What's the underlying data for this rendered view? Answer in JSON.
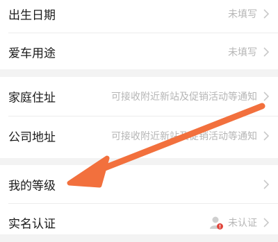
{
  "section1": {
    "rows": [
      {
        "label": "出生日期",
        "value": "未填写"
      },
      {
        "label": "爱车用途",
        "value": "未填写"
      }
    ]
  },
  "section2": {
    "rows": [
      {
        "label": "家庭住址",
        "value": "可接收附近新站及促销活动等通知"
      },
      {
        "label": "公司地址",
        "value": "可接收附近新站及促销活动等通知"
      }
    ]
  },
  "section3": {
    "rows": [
      {
        "label": "我的等级",
        "value": ""
      },
      {
        "label": "实名认证",
        "value": "未认证"
      }
    ]
  },
  "colors": {
    "arrow": "#f2703d",
    "page_background": "#f3f3f3",
    "row_background": "#ffffff",
    "muted_text": "#b6b6b6",
    "badge": "#e0443a"
  },
  "icons": {
    "chevron": "chevron-right-icon",
    "verify_avatar": "user-warning-icon",
    "pointer": "arrow-pointer-icon"
  }
}
